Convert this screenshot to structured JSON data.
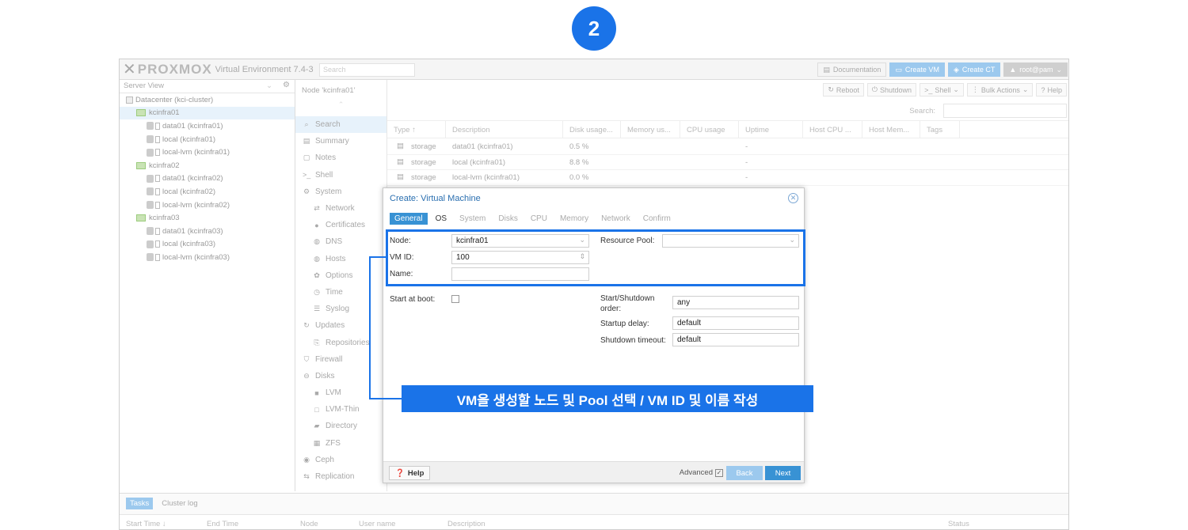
{
  "step_badge": "2",
  "header": {
    "logo_text": "PROXMOX",
    "logo_sub": "Virtual Environment 7.4-3",
    "search_placeholder": "Search",
    "documentation": "Documentation",
    "create_vm": "Create VM",
    "create_ct": "Create CT",
    "user": "root@pam"
  },
  "sidebar": {
    "view": "Server View",
    "items": [
      {
        "label": "Datacenter (kci-cluster)",
        "kind": "datacenter",
        "level": 0
      },
      {
        "label": "kcinfra01",
        "kind": "node",
        "level": 1,
        "selected": true
      },
      {
        "label": "data01 (kcinfra01)",
        "kind": "storage",
        "level": 2
      },
      {
        "label": "local (kcinfra01)",
        "kind": "storage",
        "level": 2
      },
      {
        "label": "local-lvm (kcinfra01)",
        "kind": "storage",
        "level": 2
      },
      {
        "label": "kcinfra02",
        "kind": "node",
        "level": 1
      },
      {
        "label": "data01 (kcinfra02)",
        "kind": "storage",
        "level": 2
      },
      {
        "label": "local (kcinfra02)",
        "kind": "storage",
        "level": 2
      },
      {
        "label": "local-lvm (kcinfra02)",
        "kind": "storage",
        "level": 2
      },
      {
        "label": "kcinfra03",
        "kind": "node",
        "level": 1
      },
      {
        "label": "data01 (kcinfra03)",
        "kind": "storage",
        "level": 2
      },
      {
        "label": "local (kcinfra03)",
        "kind": "storage",
        "level": 2
      },
      {
        "label": "local-lvm (kcinfra03)",
        "kind": "storage",
        "level": 2
      }
    ]
  },
  "node_title": "Node 'kcinfra01'",
  "node_actions": {
    "reboot": "Reboot",
    "shutdown": "Shutdown",
    "shell": "Shell",
    "bulk": "Bulk Actions",
    "help": "Help"
  },
  "nav": [
    {
      "label": "Search",
      "icon": "search-icon",
      "sub": false,
      "selected": true
    },
    {
      "label": "Summary",
      "icon": "book-icon",
      "sub": false
    },
    {
      "label": "Notes",
      "icon": "note-icon",
      "sub": false
    },
    {
      "label": "Shell",
      "icon": "terminal-icon",
      "sub": false
    },
    {
      "label": "System",
      "icon": "gears-icon",
      "sub": false
    },
    {
      "label": "Network",
      "icon": "exchange-icon",
      "sub": true
    },
    {
      "label": "Certificates",
      "icon": "certificate-icon",
      "sub": true
    },
    {
      "label": "DNS",
      "icon": "globe-icon",
      "sub": true
    },
    {
      "label": "Hosts",
      "icon": "globe-icon",
      "sub": true
    },
    {
      "label": "Options",
      "icon": "gear-icon",
      "sub": true
    },
    {
      "label": "Time",
      "icon": "clock-icon",
      "sub": true
    },
    {
      "label": "Syslog",
      "icon": "list-icon",
      "sub": true
    },
    {
      "label": "Updates",
      "icon": "refresh-icon",
      "sub": false
    },
    {
      "label": "Repositories",
      "icon": "files-icon",
      "sub": true
    },
    {
      "label": "Firewall",
      "icon": "shield-icon",
      "sub": false
    },
    {
      "label": "Disks",
      "icon": "hdd-icon",
      "sub": false
    },
    {
      "label": "LVM",
      "icon": "square-icon",
      "sub": true
    },
    {
      "label": "LVM-Thin",
      "icon": "square-outline-icon",
      "sub": true
    },
    {
      "label": "Directory",
      "icon": "folder-icon",
      "sub": true
    },
    {
      "label": "ZFS",
      "icon": "grid-icon",
      "sub": true
    },
    {
      "label": "Ceph",
      "icon": "ceph-icon",
      "sub": false
    },
    {
      "label": "Replication",
      "icon": "retweet-icon",
      "sub": false
    }
  ],
  "grid": {
    "search_label": "Search:",
    "columns": [
      "Type ↑",
      "Description",
      "Disk usage...",
      "Memory us...",
      "CPU usage",
      "Uptime",
      "Host CPU ...",
      "Host Mem...",
      "Tags"
    ],
    "rows": [
      {
        "type": "storage",
        "description": "data01 (kcinfra01)",
        "disk": "0.5 %",
        "uptime": "-"
      },
      {
        "type": "storage",
        "description": "local (kcinfra01)",
        "disk": "8.8 %",
        "uptime": "-"
      },
      {
        "type": "storage",
        "description": "local-lvm (kcinfra01)",
        "disk": "0.0 %",
        "uptime": "-"
      }
    ]
  },
  "bottom": {
    "tabs": [
      "Tasks",
      "Cluster log"
    ],
    "columns": [
      "Start Time ↓",
      "End Time",
      "Node",
      "User name",
      "Description",
      "Status"
    ]
  },
  "dialog": {
    "title": "Create: Virtual Machine",
    "tabs": [
      "General",
      "OS",
      "System",
      "Disks",
      "CPU",
      "Memory",
      "Network",
      "Confirm"
    ],
    "node_label": "Node:",
    "node_value": "kcinfra01",
    "vmid_label": "VM ID:",
    "vmid_value": "100",
    "name_label": "Name:",
    "name_value": "",
    "pool_label": "Resource Pool:",
    "pool_value": "",
    "start_boot_label": "Start at boot:",
    "startshut_label_1": "Start/Shutdown",
    "startshut_label_2": "order:",
    "startshut_value": "any",
    "startup_delay_label": "Startup delay:",
    "startup_delay_value": "default",
    "shutdown_timeout_label": "Shutdown timeout:",
    "shutdown_timeout_value": "default",
    "help": "Help",
    "advanced": "Advanced",
    "back": "Back",
    "next": "Next"
  },
  "callout": "VM을 생성할 노드 및 Pool 선택 / VM ID 및 이름 작성",
  "colors": {
    "accent": "#1a73e8",
    "proxmox_blue": "#3892d4",
    "light_blue": "#9cc9ee"
  }
}
